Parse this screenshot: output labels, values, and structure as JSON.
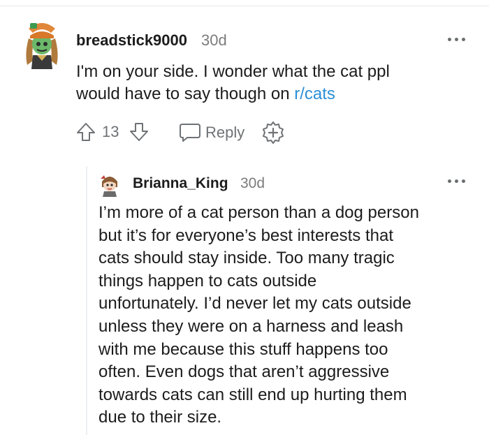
{
  "comments": [
    {
      "username": "breadstick9000",
      "age": "30d",
      "body_lines": [
        "I'm on your side. I wonder what the cat ppl",
        "would have to say though on "
      ],
      "link": "r/cats",
      "votes": "13",
      "reply_label": "Reply",
      "icons": [
        "avatar",
        "more-options-icon",
        "upvote-icon",
        "downvote-icon",
        "reply-icon",
        "award-icon"
      ]
    },
    {
      "username": "Brianna_King",
      "age": "30d",
      "body_lines": [
        "I’m more of a cat person than a dog person",
        "but it’s for everyone’s best interests that",
        "cats should stay inside. Too many tragic",
        "things happen to cats outside",
        "unfortunately. I’d never let my cats outside",
        "unless they were on a harness and leash",
        "with me because this stuff happens too",
        "often. Even dogs that aren’t aggressive",
        "towards cats can still end up hurting them",
        "due to their size."
      ],
      "icons": [
        "avatar",
        "more-options-icon"
      ]
    }
  ],
  "colors": {
    "link": "#2c8fd6",
    "meta": "#7c7c7c",
    "text": "#1c1c1c",
    "icon": "#6f7275"
  }
}
